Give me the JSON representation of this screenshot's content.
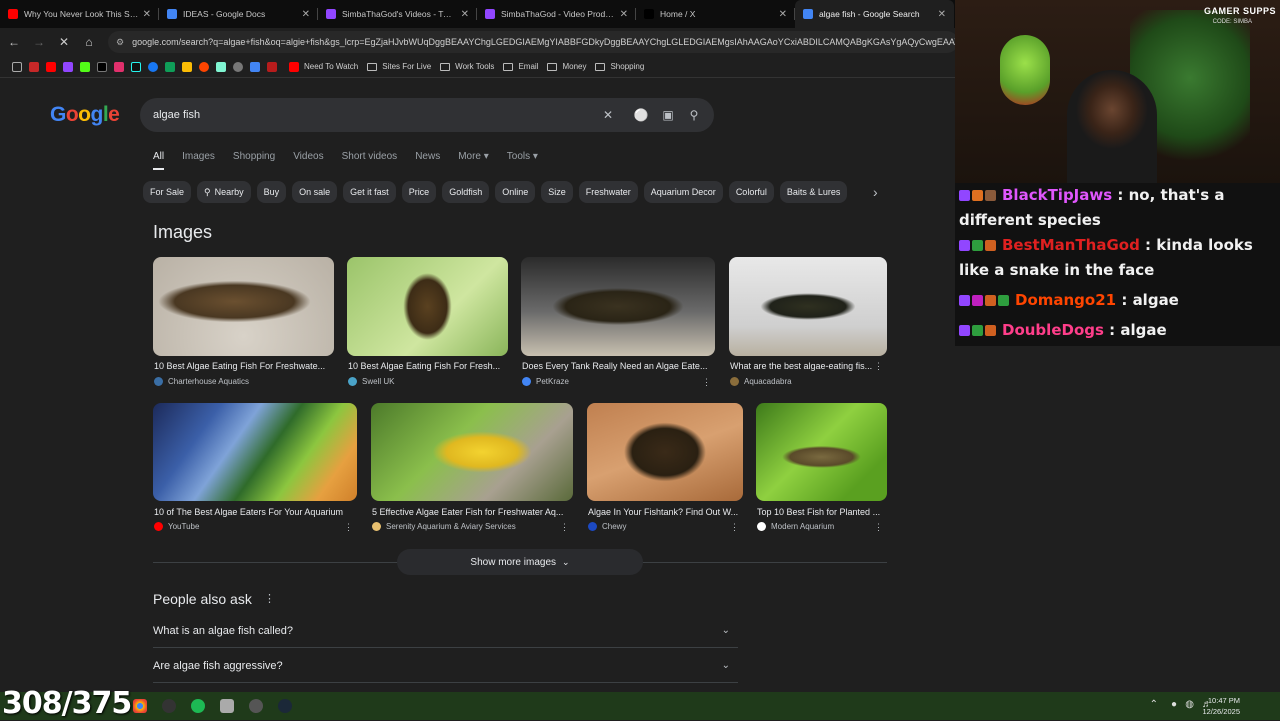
{
  "tabs": [
    {
      "title": "Why You Never Look This Sharp",
      "color": "#ff0000"
    },
    {
      "title": "IDEAS - Google Docs",
      "color": "#4285f4"
    },
    {
      "title": "SimbaThaGod's Videos - Twitch",
      "color": "#9146ff"
    },
    {
      "title": "SimbaThaGod - Video Producer",
      "color": "#9146ff"
    },
    {
      "title": "Home / X",
      "color": "#000000"
    },
    {
      "title": "algae fish - Google Search",
      "color": "#4285f4"
    }
  ],
  "address": "google.com/search?q=algae+fish&oq=algie+fish&gs_lcrp=EgZjaHJvbWUqDggBEAAYChgLGEDGIAEMgYIABBFGDkyDggBEAAYChgLGLEDGIAEMgsIAhAAGAoYCxiABDILCAMQABgKGAsYgAQyCwgEAAY",
  "bookmarks": [
    "Need To Watch",
    "Sites For Live",
    "Work Tools",
    "Email",
    "Money",
    "Shopping"
  ],
  "search": {
    "query": "algae fish"
  },
  "filters": [
    "All",
    "Images",
    "Shopping",
    "Videos",
    "Short videos",
    "News",
    "More ▾",
    "Tools ▾"
  ],
  "chips": [
    "For Sale",
    "Nearby",
    "Buy",
    "On sale",
    "Get it fast",
    "Price",
    "Goldfish",
    "Online",
    "Size",
    "Freshwater",
    "Aquarium Decor",
    "Colorful",
    "Baits & Lures"
  ],
  "images_title": "Images",
  "images": [
    {
      "caption": "10 Best Algae Eating Fish For Freshwate...",
      "source": "Charterhouse Aquatics"
    },
    {
      "caption": "10 Best Algae Eating Fish For Fresh...",
      "source": "Swell UK"
    },
    {
      "caption": "Does Every Tank Really Need an Algae Eate...",
      "source": "PetKraze"
    },
    {
      "caption": "What are the best algae-eating fis...",
      "source": "Aquacadabra"
    },
    {
      "caption": "10 of The Best Algae Eaters For Your Aquarium",
      "source": "YouTube"
    },
    {
      "caption": "5 Effective Algae Eater Fish for Freshwater Aq...",
      "source": "Serenity Aquarium & Aviary Services"
    },
    {
      "caption": "Algae In Your Fishtank? Find Out W...",
      "source": "Chewy"
    },
    {
      "caption": "Top 10 Best Fish for Planted ...",
      "source": "Modern Aquarium"
    }
  ],
  "show_more": "Show more images",
  "paa": {
    "title": "People also ask",
    "questions": [
      "What is an algae fish called?",
      "Are algae fish aggressive?"
    ]
  },
  "chat": [
    {
      "user": "BlackTipJaws",
      "color": "#e056fd",
      "message": "no, that's a different species"
    },
    {
      "user": "BestManThaGod",
      "color": "#e02020",
      "message": "kinda looks like a snake in the face"
    },
    {
      "user": "Domango21",
      "color": "#ff4500",
      "message": "algae"
    },
    {
      "user": "DoubleDogs",
      "color": "#ff3e8a",
      "message": "algae"
    }
  ],
  "overlay": {
    "counter": "308/375",
    "brand": "GAMER SUPPS",
    "code": "CODE: SIMBA"
  },
  "clock": {
    "time": "10:47 PM",
    "date": "12/26/2025"
  }
}
